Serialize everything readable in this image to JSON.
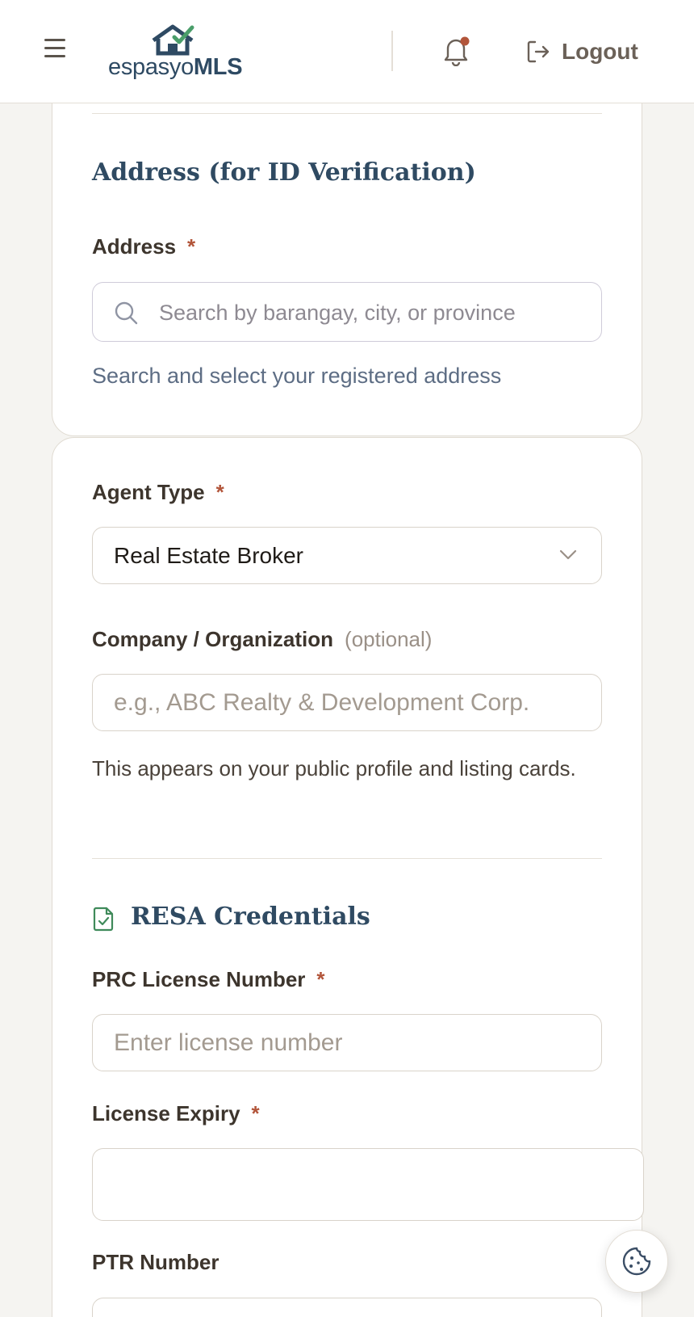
{
  "header": {
    "logo_text_regular": "espasyo",
    "logo_text_bold": "MLS",
    "notification_badge_color": "#b2553a",
    "logout_label": "Logout",
    "brand_color": "#2e4a63",
    "accent_green": "#4a9e6a"
  },
  "address_section": {
    "title": "Address (for ID Verification)",
    "address_label": "Address",
    "required_mark": "*",
    "search_placeholder": "Search by barangay, city, or province",
    "helper_text": "Search and select your registered address"
  },
  "agent_section": {
    "agent_type_label": "Agent Type",
    "agent_type_value": "Real Estate Broker",
    "company_label": "Company / Organization",
    "company_optional": "(optional)",
    "company_placeholder": "e.g., ABC Realty & Development Corp.",
    "company_helper": "This appears on your public profile and listing cards."
  },
  "resa_section": {
    "title": "RESA Credentials",
    "prc_label": "PRC License Number",
    "prc_placeholder": "Enter license number",
    "expiry_label": "License Expiry",
    "expiry_value": "",
    "ptr_label": "PTR Number"
  },
  "icons": {
    "menu": "hamburger-menu-icon",
    "bell": "bell-icon",
    "logout": "logout-icon",
    "search": "search-icon",
    "chevron": "chevron-down-icon",
    "document": "document-check-icon",
    "cookie": "cookie-icon"
  }
}
